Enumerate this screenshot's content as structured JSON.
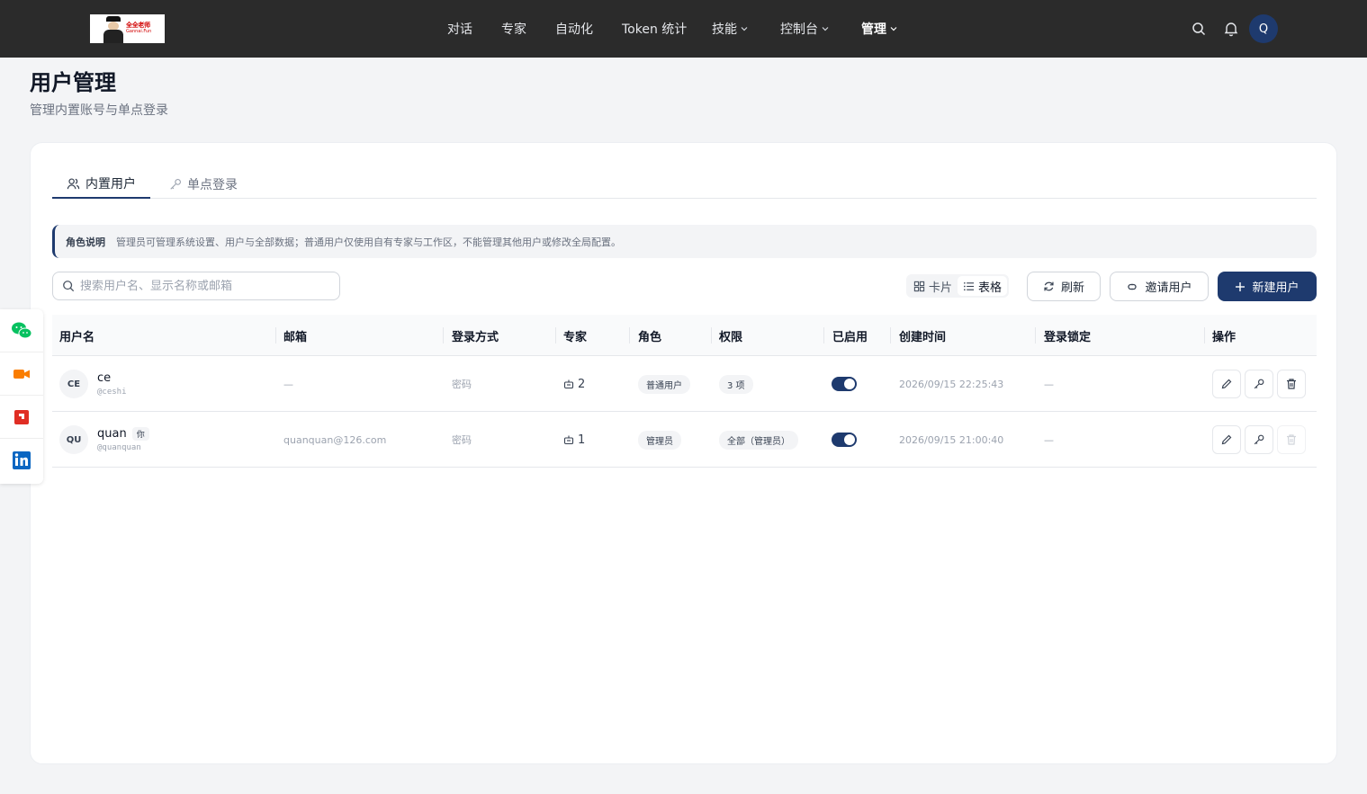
{
  "nav": {
    "logo_text_line1": "全全老师",
    "logo_text_line2": "Gannai.Fun",
    "items": [
      {
        "label": "对话",
        "has_dropdown": false
      },
      {
        "label": "专家",
        "has_dropdown": false
      },
      {
        "label": "自动化",
        "has_dropdown": false
      },
      {
        "label": "Token 统计",
        "has_dropdown": false
      },
      {
        "label": "技能",
        "has_dropdown": true
      },
      {
        "label": "控制台",
        "has_dropdown": true
      },
      {
        "label": "管理",
        "has_dropdown": true,
        "active": true
      }
    ],
    "avatar_initial": "Q"
  },
  "page": {
    "title": "用户管理",
    "subtitle": "管理内置账号与单点登录"
  },
  "tabs": [
    {
      "label": "内置用户",
      "active": true,
      "icon": "users-icon"
    },
    {
      "label": "单点登录",
      "active": false,
      "icon": "key-icon"
    }
  ],
  "notice": {
    "label": "角色说明",
    "text": "管理员可管理系统设置、用户与全部数据；普通用户仅使用自有专家与工作区，不能管理其他用户或修改全局配置。"
  },
  "toolbar": {
    "search_placeholder": "搜索用户名、显示名称或邮箱",
    "view_card": "卡片",
    "view_table": "表格",
    "refresh": "刷新",
    "invite": "邀请用户",
    "new_user": "新建用户"
  },
  "table": {
    "headers": [
      "用户名",
      "邮箱",
      "登录方式",
      "专家",
      "角色",
      "权限",
      "已启用",
      "创建时间",
      "登录锁定",
      "操作"
    ],
    "rows": [
      {
        "initials": "CE",
        "name": "ce",
        "handle": "@ceshi",
        "is_you": false,
        "you_label": "",
        "email": "—",
        "login": "密码",
        "experts": "2",
        "role": "普通用户",
        "permissions": "3 项",
        "enabled": true,
        "created": "2026/09/15 22:25:43",
        "locked": "—",
        "can_delete": true
      },
      {
        "initials": "QU",
        "name": "quan",
        "handle": "@quanquan",
        "is_you": true,
        "you_label": "你",
        "email": "quanquan@126.com",
        "login": "密码",
        "experts": "1",
        "role": "管理员",
        "permissions": "全部（管理员）",
        "enabled": true,
        "created": "2026/09/15 21:00:40",
        "locked": "—",
        "can_delete": false
      }
    ]
  },
  "colors": {
    "topbar": "#2b2b2b",
    "accent": "#1e3a6e",
    "wechat": "#07c160",
    "video": "#fa7d00",
    "red_app": "#e02e24",
    "linkedin": "#0a66c2"
  },
  "social": [
    "wechat-icon",
    "video-channel-icon",
    "red-app-icon",
    "linkedin-icon"
  ]
}
